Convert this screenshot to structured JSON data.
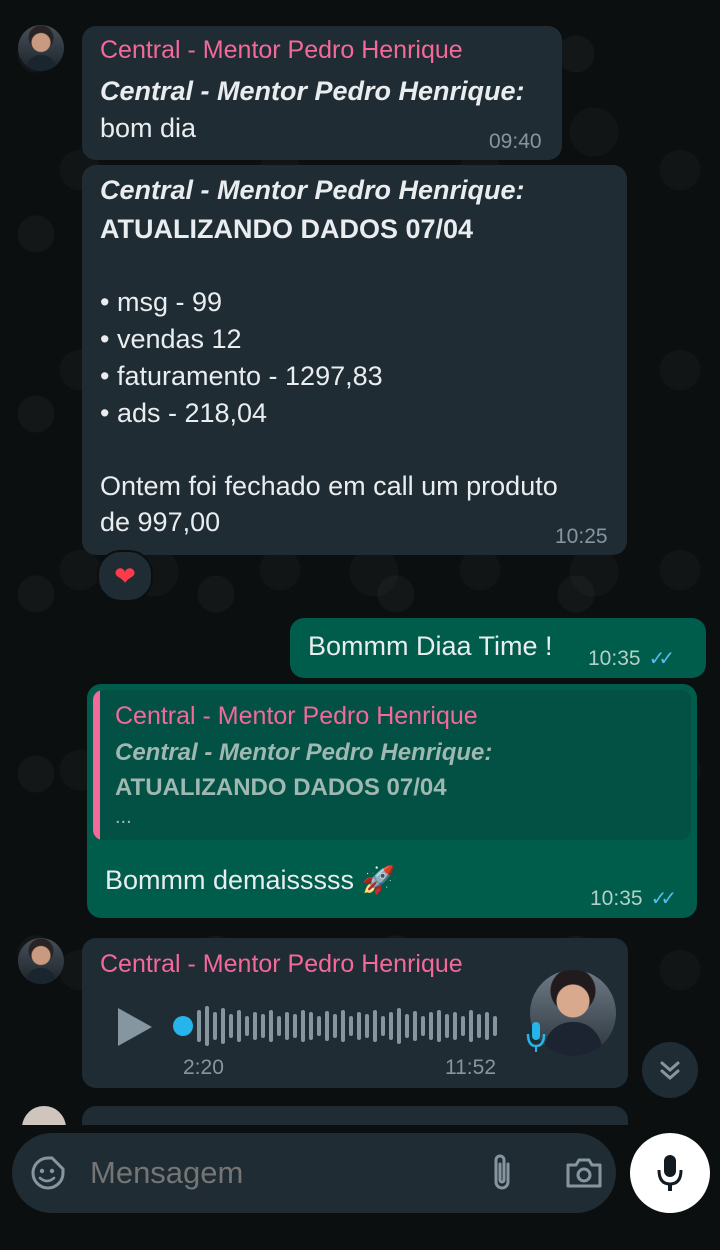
{
  "messages": [
    {
      "sender": "Central - Mentor Pedro Henrique",
      "header": "Central - Mentor Pedro Henrique:",
      "text": "bom dia",
      "time": "09:40"
    },
    {
      "header": "Central - Mentor Pedro Henrique:",
      "title": "ATUALIZANDO DADOS 07/04",
      "lines": [
        "• msg - 99",
        "• vendas 12",
        "• faturamento - 1297,83",
        "• ads - 218,04"
      ],
      "footer_line1": "Ontem foi fechado em call um produto",
      "footer_line2": "de 997,00",
      "time": "10:25",
      "reaction": "❤"
    },
    {
      "text": "Bommm Diaa Time !",
      "time": "10:35"
    },
    {
      "quote_sender": "Central - Mentor Pedro Henrique",
      "quote_header": "Central - Mentor Pedro Henrique:",
      "quote_title": "ATUALIZANDO DADOS 07/04",
      "quote_more": "...",
      "text": "Bommm demaisssss 🚀",
      "time": "10:35"
    },
    {
      "sender": "Central - Mentor Pedro Henrique",
      "duration": "2:20",
      "time": "11:52"
    }
  ],
  "input": {
    "placeholder": "Mensagem"
  },
  "colors": {
    "sender": "#f2699a",
    "incoming_bubble": "#202c33",
    "outgoing_bubble": "#005c4b",
    "read_ticks": "#53bdeb"
  }
}
